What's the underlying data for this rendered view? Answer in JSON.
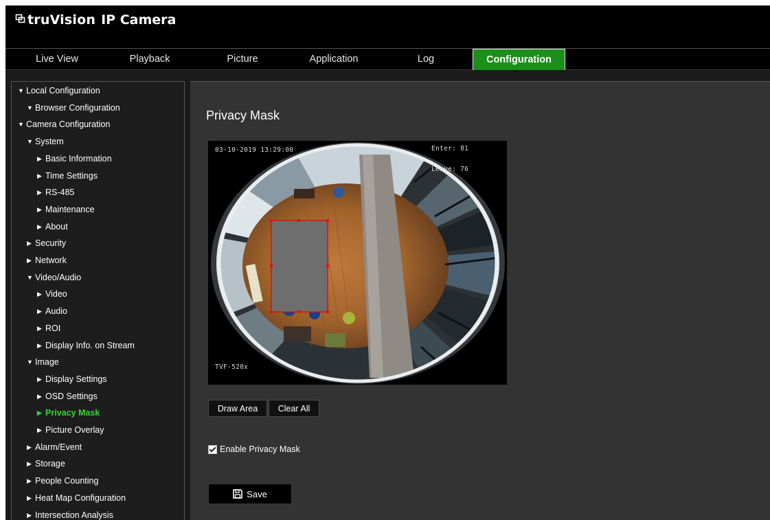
{
  "header": {
    "brand": "truVision",
    "product": "IP Camera",
    "logo_icon": "truvision-logo-icon"
  },
  "nav": {
    "tabs": [
      {
        "label": "Live View",
        "active": false
      },
      {
        "label": "Playback",
        "active": false
      },
      {
        "label": "Picture",
        "active": false
      },
      {
        "label": "Application",
        "active": false
      },
      {
        "label": "Log",
        "active": false
      },
      {
        "label": "Configuration",
        "active": true
      }
    ]
  },
  "sidebar": {
    "items": [
      {
        "label": "Local Configuration",
        "level": 0,
        "expanded": true
      },
      {
        "label": "Browser Configuration",
        "level": 1,
        "expanded": true
      },
      {
        "label": "Camera Configuration",
        "level": 0,
        "expanded": true
      },
      {
        "label": "System",
        "level": 1,
        "expanded": true
      },
      {
        "label": "Basic Information",
        "level": 2,
        "expanded": false
      },
      {
        "label": "Time Settings",
        "level": 2,
        "expanded": false
      },
      {
        "label": "RS-485",
        "level": 2,
        "expanded": false
      },
      {
        "label": "Maintenance",
        "level": 2,
        "expanded": false
      },
      {
        "label": "About",
        "level": 2,
        "expanded": false
      },
      {
        "label": "Security",
        "level": 1,
        "expanded": false
      },
      {
        "label": "Network",
        "level": 1,
        "expanded": false
      },
      {
        "label": "Video/Audio",
        "level": 1,
        "expanded": true
      },
      {
        "label": "Video",
        "level": 2,
        "expanded": false
      },
      {
        "label": "Audio",
        "level": 2,
        "expanded": false
      },
      {
        "label": "ROI",
        "level": 2,
        "expanded": false
      },
      {
        "label": "Display Info. on Stream",
        "level": 2,
        "expanded": false
      },
      {
        "label": "Image",
        "level": 1,
        "expanded": true
      },
      {
        "label": "Display Settings",
        "level": 2,
        "expanded": false
      },
      {
        "label": "OSD Settings",
        "level": 2,
        "expanded": false
      },
      {
        "label": "Privacy Mask",
        "level": 2,
        "expanded": false,
        "active": true
      },
      {
        "label": "Picture Overlay",
        "level": 2,
        "expanded": false
      },
      {
        "label": "Alarm/Event",
        "level": 1,
        "expanded": false
      },
      {
        "label": "Storage",
        "level": 1,
        "expanded": false
      },
      {
        "label": "People Counting",
        "level": 1,
        "expanded": false
      },
      {
        "label": "Heat Map Configuration",
        "level": 1,
        "expanded": false
      },
      {
        "label": "Intersection Analysis",
        "level": 1,
        "expanded": false
      }
    ]
  },
  "main": {
    "title": "Privacy Mask",
    "video": {
      "timestamp": "03-10-2019 13:29:00",
      "enter": "Enter: 81",
      "leave": "Leave: 76",
      "camera_name": "TVF-520x"
    },
    "buttons": {
      "draw_area": "Draw Area",
      "clear_all": "Clear All",
      "save": "Save"
    },
    "enable_privacy_mask": {
      "label": "Enable Privacy Mask",
      "checked": true
    }
  },
  "colors": {
    "active_tab": "#1a8f1a",
    "active_menu_text": "#38d538",
    "mask_border": "#e01010",
    "mask_fill": "#6e6e6e"
  }
}
